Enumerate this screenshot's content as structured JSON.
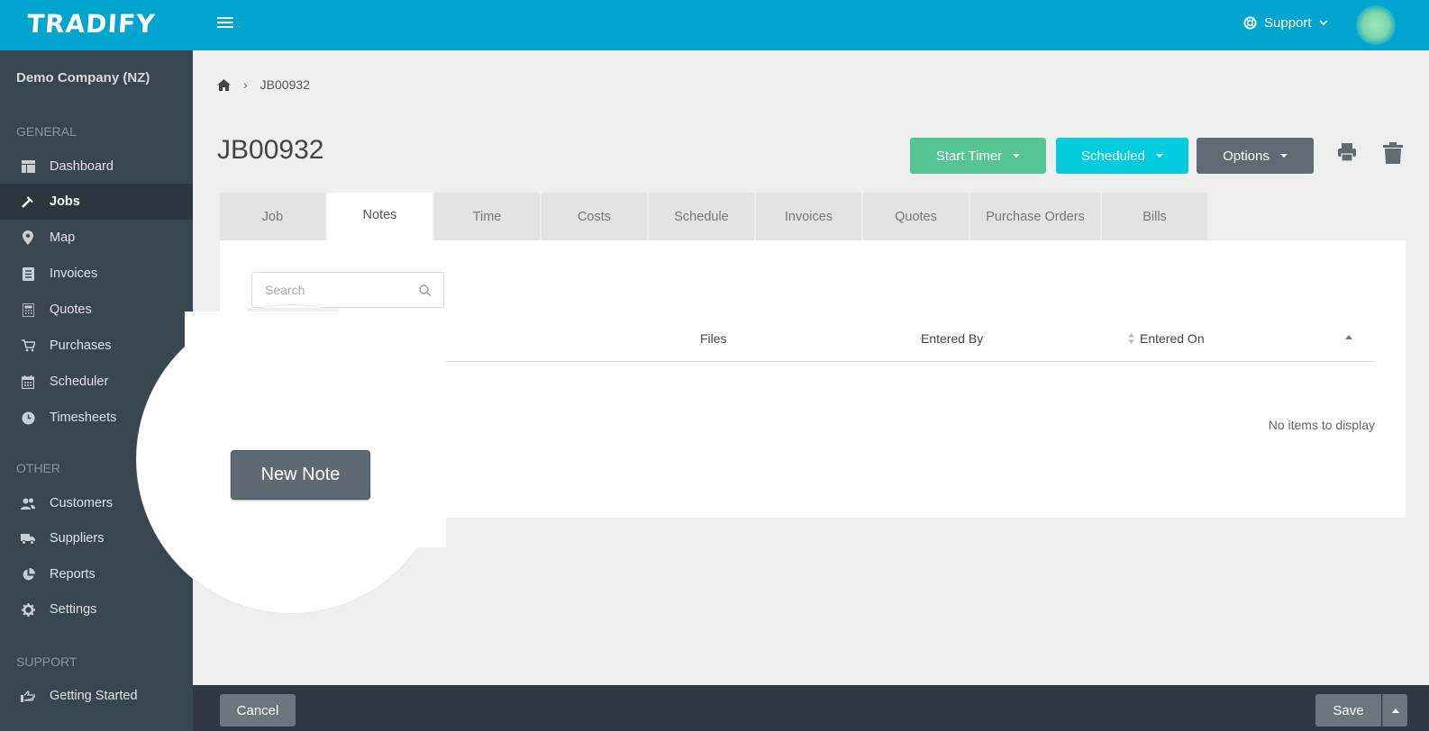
{
  "app": {
    "brand": "TRADIFY"
  },
  "header": {
    "support_label": "Support"
  },
  "sidebar": {
    "company": "Demo Company (NZ)",
    "sections": {
      "general": "GENERAL",
      "other": "OTHER",
      "support": "SUPPORT"
    },
    "items": [
      {
        "label": "Dashboard",
        "icon": "dashboard-icon"
      },
      {
        "label": "Jobs",
        "icon": "hammer-icon",
        "active": true
      },
      {
        "label": "Map",
        "icon": "map-pin-icon"
      },
      {
        "label": "Invoices",
        "icon": "invoice-icon"
      },
      {
        "label": "Quotes",
        "icon": "calculator-icon"
      },
      {
        "label": "Purchases",
        "icon": "cart-icon"
      },
      {
        "label": "Scheduler",
        "icon": "calendar-icon"
      },
      {
        "label": "Timesheets",
        "icon": "clock-icon"
      },
      {
        "label": "Customers",
        "icon": "users-icon"
      },
      {
        "label": "Suppliers",
        "icon": "truck-icon"
      },
      {
        "label": "Reports",
        "icon": "pie-chart-icon"
      },
      {
        "label": "Settings",
        "icon": "gear-icon"
      },
      {
        "label": "Getting Started",
        "icon": "hand-pointer-icon"
      }
    ]
  },
  "breadcrumb": {
    "current": "JB00932"
  },
  "job": {
    "title": "JB00932"
  },
  "actions": {
    "start_timer": "Start Timer",
    "scheduled": "Scheduled",
    "options": "Options"
  },
  "tabs": [
    "Job",
    "Notes",
    "Time",
    "Costs",
    "Schedule",
    "Invoices",
    "Quotes",
    "Purchase Orders",
    "Bills"
  ],
  "active_tab": "Notes",
  "notes": {
    "search_placeholder": "Search",
    "columns": {
      "files": "Files",
      "entered_by": "Entered By",
      "entered_on": "Entered On"
    },
    "empty_message": "No items to display",
    "new_note_label": "New Note"
  },
  "footer": {
    "cancel": "Cancel",
    "save": "Save"
  },
  "colors": {
    "topbar": "#00a5cf",
    "sidebar": "#38464e",
    "start_timer": "#55c595",
    "scheduled": "#00ccde",
    "options": "#5f6b71"
  }
}
